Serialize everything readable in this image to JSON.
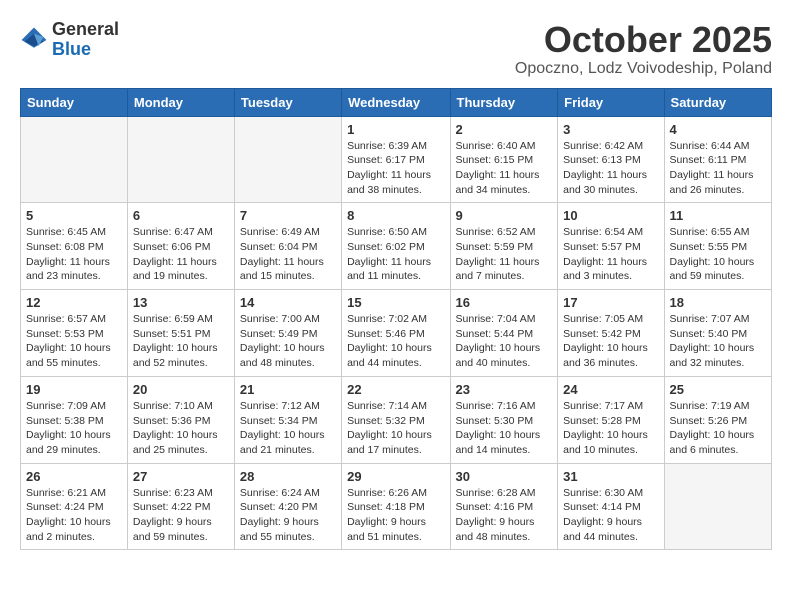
{
  "logo": {
    "general": "General",
    "blue": "Blue"
  },
  "header": {
    "month": "October 2025",
    "location": "Opoczno, Lodz Voivodeship, Poland"
  },
  "weekdays": [
    "Sunday",
    "Monday",
    "Tuesday",
    "Wednesday",
    "Thursday",
    "Friday",
    "Saturday"
  ],
  "weeks": [
    [
      {
        "day": "",
        "info": "",
        "empty": true
      },
      {
        "day": "",
        "info": "",
        "empty": true
      },
      {
        "day": "",
        "info": "",
        "empty": true
      },
      {
        "day": "1",
        "info": "Sunrise: 6:39 AM\nSunset: 6:17 PM\nDaylight: 11 hours\nand 38 minutes.",
        "empty": false
      },
      {
        "day": "2",
        "info": "Sunrise: 6:40 AM\nSunset: 6:15 PM\nDaylight: 11 hours\nand 34 minutes.",
        "empty": false
      },
      {
        "day": "3",
        "info": "Sunrise: 6:42 AM\nSunset: 6:13 PM\nDaylight: 11 hours\nand 30 minutes.",
        "empty": false
      },
      {
        "day": "4",
        "info": "Sunrise: 6:44 AM\nSunset: 6:11 PM\nDaylight: 11 hours\nand 26 minutes.",
        "empty": false
      }
    ],
    [
      {
        "day": "5",
        "info": "Sunrise: 6:45 AM\nSunset: 6:08 PM\nDaylight: 11 hours\nand 23 minutes.",
        "empty": false
      },
      {
        "day": "6",
        "info": "Sunrise: 6:47 AM\nSunset: 6:06 PM\nDaylight: 11 hours\nand 19 minutes.",
        "empty": false
      },
      {
        "day": "7",
        "info": "Sunrise: 6:49 AM\nSunset: 6:04 PM\nDaylight: 11 hours\nand 15 minutes.",
        "empty": false
      },
      {
        "day": "8",
        "info": "Sunrise: 6:50 AM\nSunset: 6:02 PM\nDaylight: 11 hours\nand 11 minutes.",
        "empty": false
      },
      {
        "day": "9",
        "info": "Sunrise: 6:52 AM\nSunset: 5:59 PM\nDaylight: 11 hours\nand 7 minutes.",
        "empty": false
      },
      {
        "day": "10",
        "info": "Sunrise: 6:54 AM\nSunset: 5:57 PM\nDaylight: 11 hours\nand 3 minutes.",
        "empty": false
      },
      {
        "day": "11",
        "info": "Sunrise: 6:55 AM\nSunset: 5:55 PM\nDaylight: 10 hours\nand 59 minutes.",
        "empty": false
      }
    ],
    [
      {
        "day": "12",
        "info": "Sunrise: 6:57 AM\nSunset: 5:53 PM\nDaylight: 10 hours\nand 55 minutes.",
        "empty": false
      },
      {
        "day": "13",
        "info": "Sunrise: 6:59 AM\nSunset: 5:51 PM\nDaylight: 10 hours\nand 52 minutes.",
        "empty": false
      },
      {
        "day": "14",
        "info": "Sunrise: 7:00 AM\nSunset: 5:49 PM\nDaylight: 10 hours\nand 48 minutes.",
        "empty": false
      },
      {
        "day": "15",
        "info": "Sunrise: 7:02 AM\nSunset: 5:46 PM\nDaylight: 10 hours\nand 44 minutes.",
        "empty": false
      },
      {
        "day": "16",
        "info": "Sunrise: 7:04 AM\nSunset: 5:44 PM\nDaylight: 10 hours\nand 40 minutes.",
        "empty": false
      },
      {
        "day": "17",
        "info": "Sunrise: 7:05 AM\nSunset: 5:42 PM\nDaylight: 10 hours\nand 36 minutes.",
        "empty": false
      },
      {
        "day": "18",
        "info": "Sunrise: 7:07 AM\nSunset: 5:40 PM\nDaylight: 10 hours\nand 32 minutes.",
        "empty": false
      }
    ],
    [
      {
        "day": "19",
        "info": "Sunrise: 7:09 AM\nSunset: 5:38 PM\nDaylight: 10 hours\nand 29 minutes.",
        "empty": false
      },
      {
        "day": "20",
        "info": "Sunrise: 7:10 AM\nSunset: 5:36 PM\nDaylight: 10 hours\nand 25 minutes.",
        "empty": false
      },
      {
        "day": "21",
        "info": "Sunrise: 7:12 AM\nSunset: 5:34 PM\nDaylight: 10 hours\nand 21 minutes.",
        "empty": false
      },
      {
        "day": "22",
        "info": "Sunrise: 7:14 AM\nSunset: 5:32 PM\nDaylight: 10 hours\nand 17 minutes.",
        "empty": false
      },
      {
        "day": "23",
        "info": "Sunrise: 7:16 AM\nSunset: 5:30 PM\nDaylight: 10 hours\nand 14 minutes.",
        "empty": false
      },
      {
        "day": "24",
        "info": "Sunrise: 7:17 AM\nSunset: 5:28 PM\nDaylight: 10 hours\nand 10 minutes.",
        "empty": false
      },
      {
        "day": "25",
        "info": "Sunrise: 7:19 AM\nSunset: 5:26 PM\nDaylight: 10 hours\nand 6 minutes.",
        "empty": false
      }
    ],
    [
      {
        "day": "26",
        "info": "Sunrise: 6:21 AM\nSunset: 4:24 PM\nDaylight: 10 hours\nand 2 minutes.",
        "empty": false
      },
      {
        "day": "27",
        "info": "Sunrise: 6:23 AM\nSunset: 4:22 PM\nDaylight: 9 hours\nand 59 minutes.",
        "empty": false
      },
      {
        "day": "28",
        "info": "Sunrise: 6:24 AM\nSunset: 4:20 PM\nDaylight: 9 hours\nand 55 minutes.",
        "empty": false
      },
      {
        "day": "29",
        "info": "Sunrise: 6:26 AM\nSunset: 4:18 PM\nDaylight: 9 hours\nand 51 minutes.",
        "empty": false
      },
      {
        "day": "30",
        "info": "Sunrise: 6:28 AM\nSunset: 4:16 PM\nDaylight: 9 hours\nand 48 minutes.",
        "empty": false
      },
      {
        "day": "31",
        "info": "Sunrise: 6:30 AM\nSunset: 4:14 PM\nDaylight: 9 hours\nand 44 minutes.",
        "empty": false
      },
      {
        "day": "",
        "info": "",
        "empty": true
      }
    ]
  ]
}
